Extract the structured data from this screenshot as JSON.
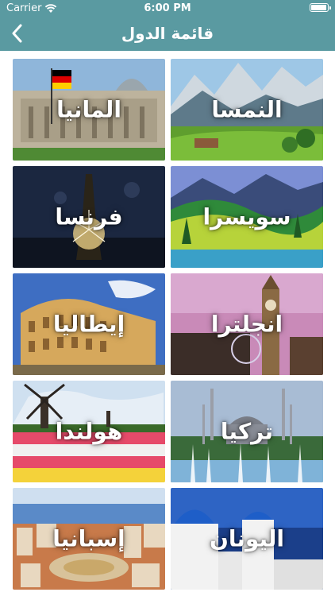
{
  "status": {
    "carrier": "Carrier",
    "time": "6:00 PM"
  },
  "nav": {
    "title": "قائمة الدول"
  },
  "countries": [
    {
      "name": "النمسا"
    },
    {
      "name": "المانيا"
    },
    {
      "name": "سويسرا"
    },
    {
      "name": "فرنسا"
    },
    {
      "name": "انجلترا"
    },
    {
      "name": "إيطاليا"
    },
    {
      "name": "تركيا"
    },
    {
      "name": "هولندا"
    },
    {
      "name": "اليونان"
    },
    {
      "name": "إسبانيا"
    }
  ]
}
